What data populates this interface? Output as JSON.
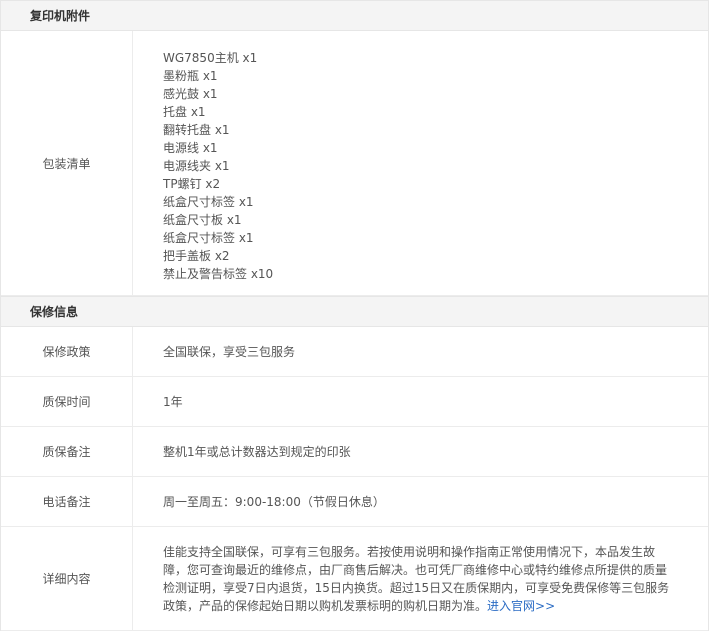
{
  "sections": {
    "accessories": {
      "title": "复印机附件",
      "package_label": "包装清单",
      "package_items": [
        "WG7850主机 x1",
        "墨粉瓶 x1",
        "感光鼓 x1",
        "托盘 x1",
        "翻转托盘 x1",
        "电源线 x1",
        "电源线夹 x1",
        "TP螺钉 x2",
        "纸盒尺寸标签 x1",
        "纸盒尺寸板 x1",
        "纸盒尺寸标签 x1",
        "把手盖板 x2",
        "禁止及警告标签 x10"
      ]
    },
    "warranty": {
      "title": "保修信息",
      "rows": [
        {
          "label": "保修政策",
          "value": "全国联保，享受三包服务"
        },
        {
          "label": "质保时间",
          "value": "1年"
        },
        {
          "label": "质保备注",
          "value": "整机1年或总计数器达到规定的印张"
        },
        {
          "label": "电话备注",
          "value": "周一至周五：9:00-18:00（节假日休息）"
        }
      ],
      "detail_label": "详细内容",
      "detail_text": "佳能支持全国联保，可享有三包服务。若按使用说明和操作指南正常使用情况下，本品发生故障，您可查询最近的维修点，由厂商售后解决。也可凭厂商维修中心或特约维修点所提供的质量检测证明，享受7日内退货，15日内换货。超过15日又在质保期内，可享受免费保修等三包服务政策，产品的保修起始日期以购机发票标明的购机日期为准。",
      "detail_link": "进入官网>>"
    }
  },
  "colors": {
    "header_bg": "#f4f4f4",
    "border": "#ececec",
    "link": "#2b6cc4",
    "text": "#555555"
  }
}
